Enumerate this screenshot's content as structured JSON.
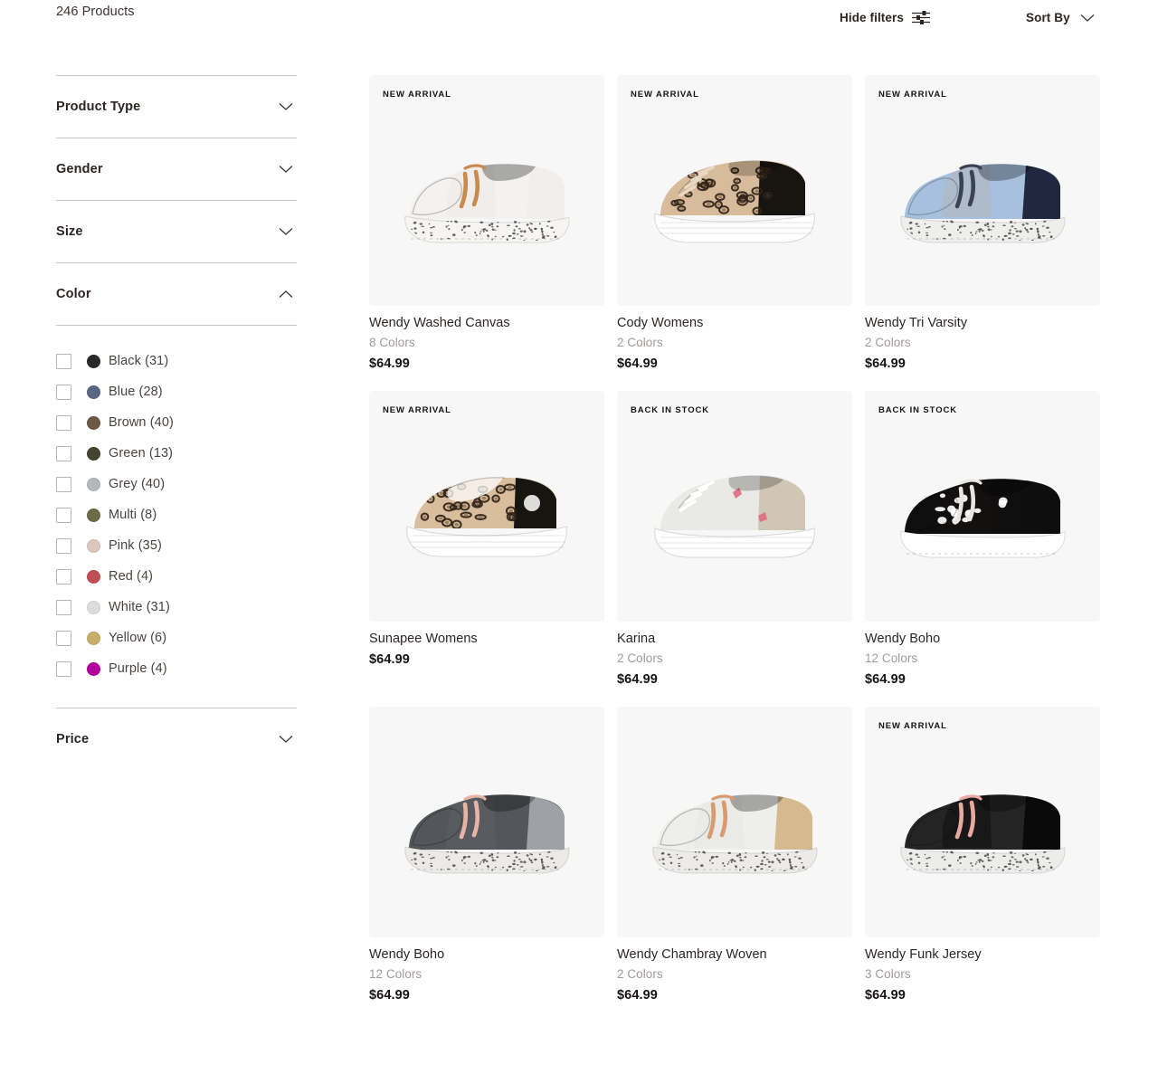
{
  "header": {
    "product_count": "246 Products",
    "hide_filters_label": "Hide filters",
    "hide_filters_icon": "filter-sliders-icon",
    "sort_by_label": "Sort By",
    "sort_by_icon": "chevron-down-icon"
  },
  "sidebar": {
    "facets": [
      {
        "title": "Product Type",
        "state": "collapsed",
        "icon": "chevron-down-icon"
      },
      {
        "title": "Gender",
        "state": "collapsed",
        "icon": "chevron-down-icon"
      },
      {
        "title": "Size",
        "state": "collapsed",
        "icon": "chevron-down-icon"
      },
      {
        "title": "Color",
        "state": "expanded",
        "icon": "chevron-up-icon"
      },
      {
        "title": "Price",
        "state": "collapsed",
        "icon": "chevron-down-icon"
      }
    ],
    "colors": [
      {
        "label": "Black (31)",
        "swatch": "#2a2a2c",
        "checked": false
      },
      {
        "label": "Blue (28)",
        "swatch": "#5a6780",
        "checked": false
      },
      {
        "label": "Brown (40)",
        "swatch": "#6c5845",
        "checked": false
      },
      {
        "label": "Green (13)",
        "swatch": "#44432f",
        "checked": false
      },
      {
        "label": "Grey (40)",
        "swatch": "#b5b8bb",
        "checked": false
      },
      {
        "label": "Multi (8)",
        "swatch": "#6d6b45",
        "checked": false
      },
      {
        "label": "Pink (35)",
        "swatch": "#ddc6bd",
        "checked": false
      },
      {
        "label": "Red (4)",
        "swatch": "#bf4f54",
        "checked": false
      },
      {
        "label": "White (31)",
        "swatch": "#dcdcdc",
        "checked": false
      },
      {
        "label": "Yellow (6)",
        "swatch": "#c6ad6a",
        "checked": false
      },
      {
        "label": "Purple (4)",
        "swatch": "#b5009e",
        "checked": false
      }
    ]
  },
  "products": [
    {
      "badge": "NEW ARRIVAL",
      "name": "Wendy Washed Canvas",
      "colors": "8 Colors",
      "price": "$64.99",
      "style": "wendy",
      "upper": "#f3f2f0",
      "upper2": "#eceae7",
      "heel": "#f1efec",
      "sole": "#f6f5f2",
      "lace": "#c98a4e",
      "speckled": true
    },
    {
      "badge": "NEW ARRIVAL",
      "name": "Cody Womens",
      "colors": "2 Colors",
      "price": "$64.99",
      "style": "sneaker",
      "upper": "#d8bb9a",
      "upper2": "#d8bb9a",
      "heel": "#17150f",
      "sole": "#ffffff",
      "lace": "#e8d8c4",
      "leopard": true
    },
    {
      "badge": "NEW ARRIVAL",
      "name": "Wendy Tri Varsity",
      "colors": "2 Colors",
      "price": "$64.99",
      "style": "wendy",
      "upper": "#a6c0dd",
      "upper2": "#b3b7ba",
      "heel": "#20273f",
      "sole": "#eeeeec",
      "lace": "#3b4252",
      "speckled": true
    },
    {
      "badge": "NEW ARRIVAL",
      "name": "Sunapee Womens",
      "colors": "",
      "price": "$64.99",
      "style": "slip",
      "upper": "#d9bd9c",
      "upper2": "#d9bd9c",
      "heel": "#17150f",
      "sole": "#ffffff",
      "lace": "",
      "leopard": true
    },
    {
      "badge": "BACK IN STOCK",
      "name": "Karina",
      "colors": "2 Colors",
      "price": "$64.99",
      "style": "sneaker",
      "upper": "#e9e9e6",
      "upper2": "#ddd9d1",
      "heel": "#cfc6b5",
      "sole": "#ffffff",
      "lace": "#ffffff",
      "accent": "#e06a80"
    },
    {
      "badge": "BACK IN STOCK",
      "name": "Wendy Boho",
      "colors": "12 Colors",
      "price": "$64.99",
      "style": "wendy",
      "upper": "#100f0f",
      "upper2": "#151313",
      "heel": "#0f0e0e",
      "sole": "#ffffff",
      "lace": "#e8e6e2",
      "cow": true
    },
    {
      "badge": "",
      "name": "Wendy Boho",
      "colors": "12 Colors",
      "price": "$64.99",
      "style": "wendy",
      "upper": "#53565a",
      "upper2": "#5d6065",
      "heel": "#9ea2a6",
      "sole": "#eceae7",
      "lace": "#e7b4a6",
      "speckled": true
    },
    {
      "badge": "",
      "name": "Wendy Chambray Woven",
      "colors": "2 Colors",
      "price": "$64.99",
      "style": "wendy",
      "upper": "#eeeeea",
      "upper2": "#e8e8e3",
      "heel": "#d6b98e",
      "sole": "#edebe7",
      "lace": "#d89a6e",
      "speckled": true
    },
    {
      "badge": "NEW ARRIVAL",
      "name": "Wendy Funk Jersey",
      "colors": "3 Colors",
      "price": "$64.99",
      "style": "wendy",
      "upper": "#242425",
      "upper2": "#100f10",
      "heel": "#0b0a0b",
      "sole": "#ececea",
      "lace": "#e7a9a0",
      "speckled": true
    }
  ]
}
